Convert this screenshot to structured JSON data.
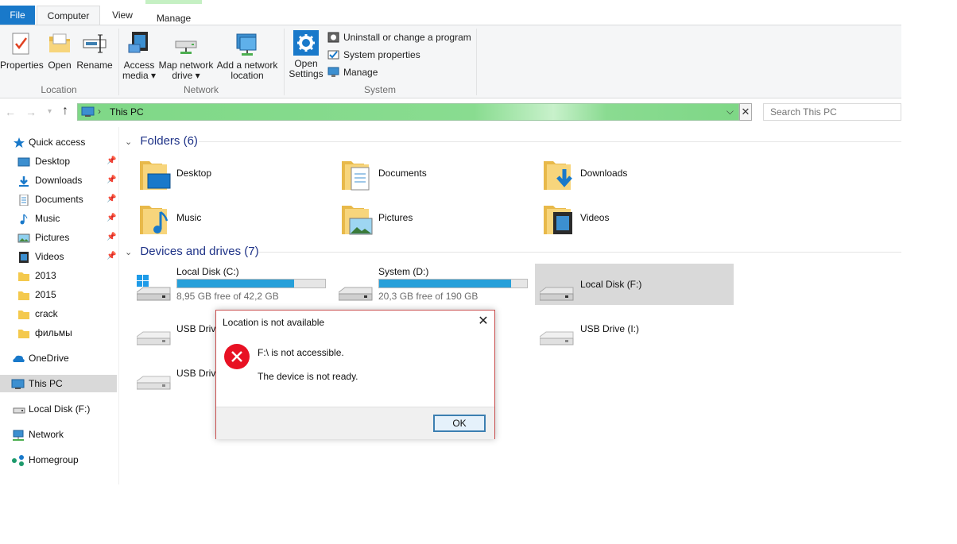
{
  "ribbon_tabs": {
    "file": "File",
    "computer": "Computer",
    "view": "View",
    "manage": "Manage"
  },
  "ribbon": {
    "location": {
      "label": "Location",
      "properties": "Properties",
      "open": "Open",
      "rename": "Rename"
    },
    "network": {
      "label": "Network",
      "access_media_1": "Access",
      "access_media_2": "media ▾",
      "map_drive_1": "Map network",
      "map_drive_2": "drive ▾",
      "add_location_1": "Add a network",
      "add_location_2": "location"
    },
    "system": {
      "label": "System",
      "open_settings_1": "Open",
      "open_settings_2": "Settings",
      "uninstall": "Uninstall or change a program",
      "system_properties": "System properties",
      "manage": "Manage"
    }
  },
  "navigation": {
    "back": "←",
    "forward": "→",
    "recent": "▾",
    "up": "↑",
    "address": "This PC",
    "address_chevron": "›",
    "dropdown": "⌵",
    "clear": "✕",
    "search_placeholder": "Search This PC"
  },
  "nav_pane": {
    "quick_access": "Quick access",
    "items": [
      {
        "label": "Desktop",
        "pin": "📌"
      },
      {
        "label": "Downloads",
        "pin": "📌"
      },
      {
        "label": "Documents",
        "pin": "📌"
      },
      {
        "label": "Music",
        "pin": "📌"
      },
      {
        "label": "Pictures",
        "pin": "📌"
      },
      {
        "label": "Videos",
        "pin": "📌"
      },
      {
        "label": "2013"
      },
      {
        "label": "2015"
      },
      {
        "label": "crack"
      },
      {
        "label": "фильмы"
      }
    ],
    "onedrive": "OneDrive",
    "this_pc": "This PC",
    "local_disk_f": "Local Disk (F:)",
    "network": "Network",
    "homegroup": "Homegroup"
  },
  "folders_section": {
    "title": "Folders (6)",
    "chevron": "⌄",
    "items": [
      "Desktop",
      "Documents",
      "Downloads",
      "Music",
      "Pictures",
      "Videos"
    ]
  },
  "devices_section": {
    "title": "Devices and drives (7)",
    "chevron": "⌄",
    "drives": [
      {
        "label": "Local Disk (C:)",
        "free": "8,95 GB free of 42,2 GB",
        "used_fraction": 0.79
      },
      {
        "label": "System (D:)",
        "free": "20,3 GB free of 190 GB",
        "used_fraction": 0.89
      },
      {
        "label": "Local Disk (F:)"
      },
      {
        "label": "USB Drive"
      },
      {
        "label": "USB Drive (I:)"
      },
      {
        "label": "USB Drive"
      }
    ]
  },
  "dialog": {
    "title": "Location is not available",
    "close": "✕",
    "message_1": "F:\\ is not accessible.",
    "message_2": "The device is not ready.",
    "ok": "OK"
  },
  "colors": {
    "file_tab": "#1979ca",
    "accent_blue": "#26a0da",
    "error_red": "#e81123",
    "address_green": "#7fd887"
  }
}
